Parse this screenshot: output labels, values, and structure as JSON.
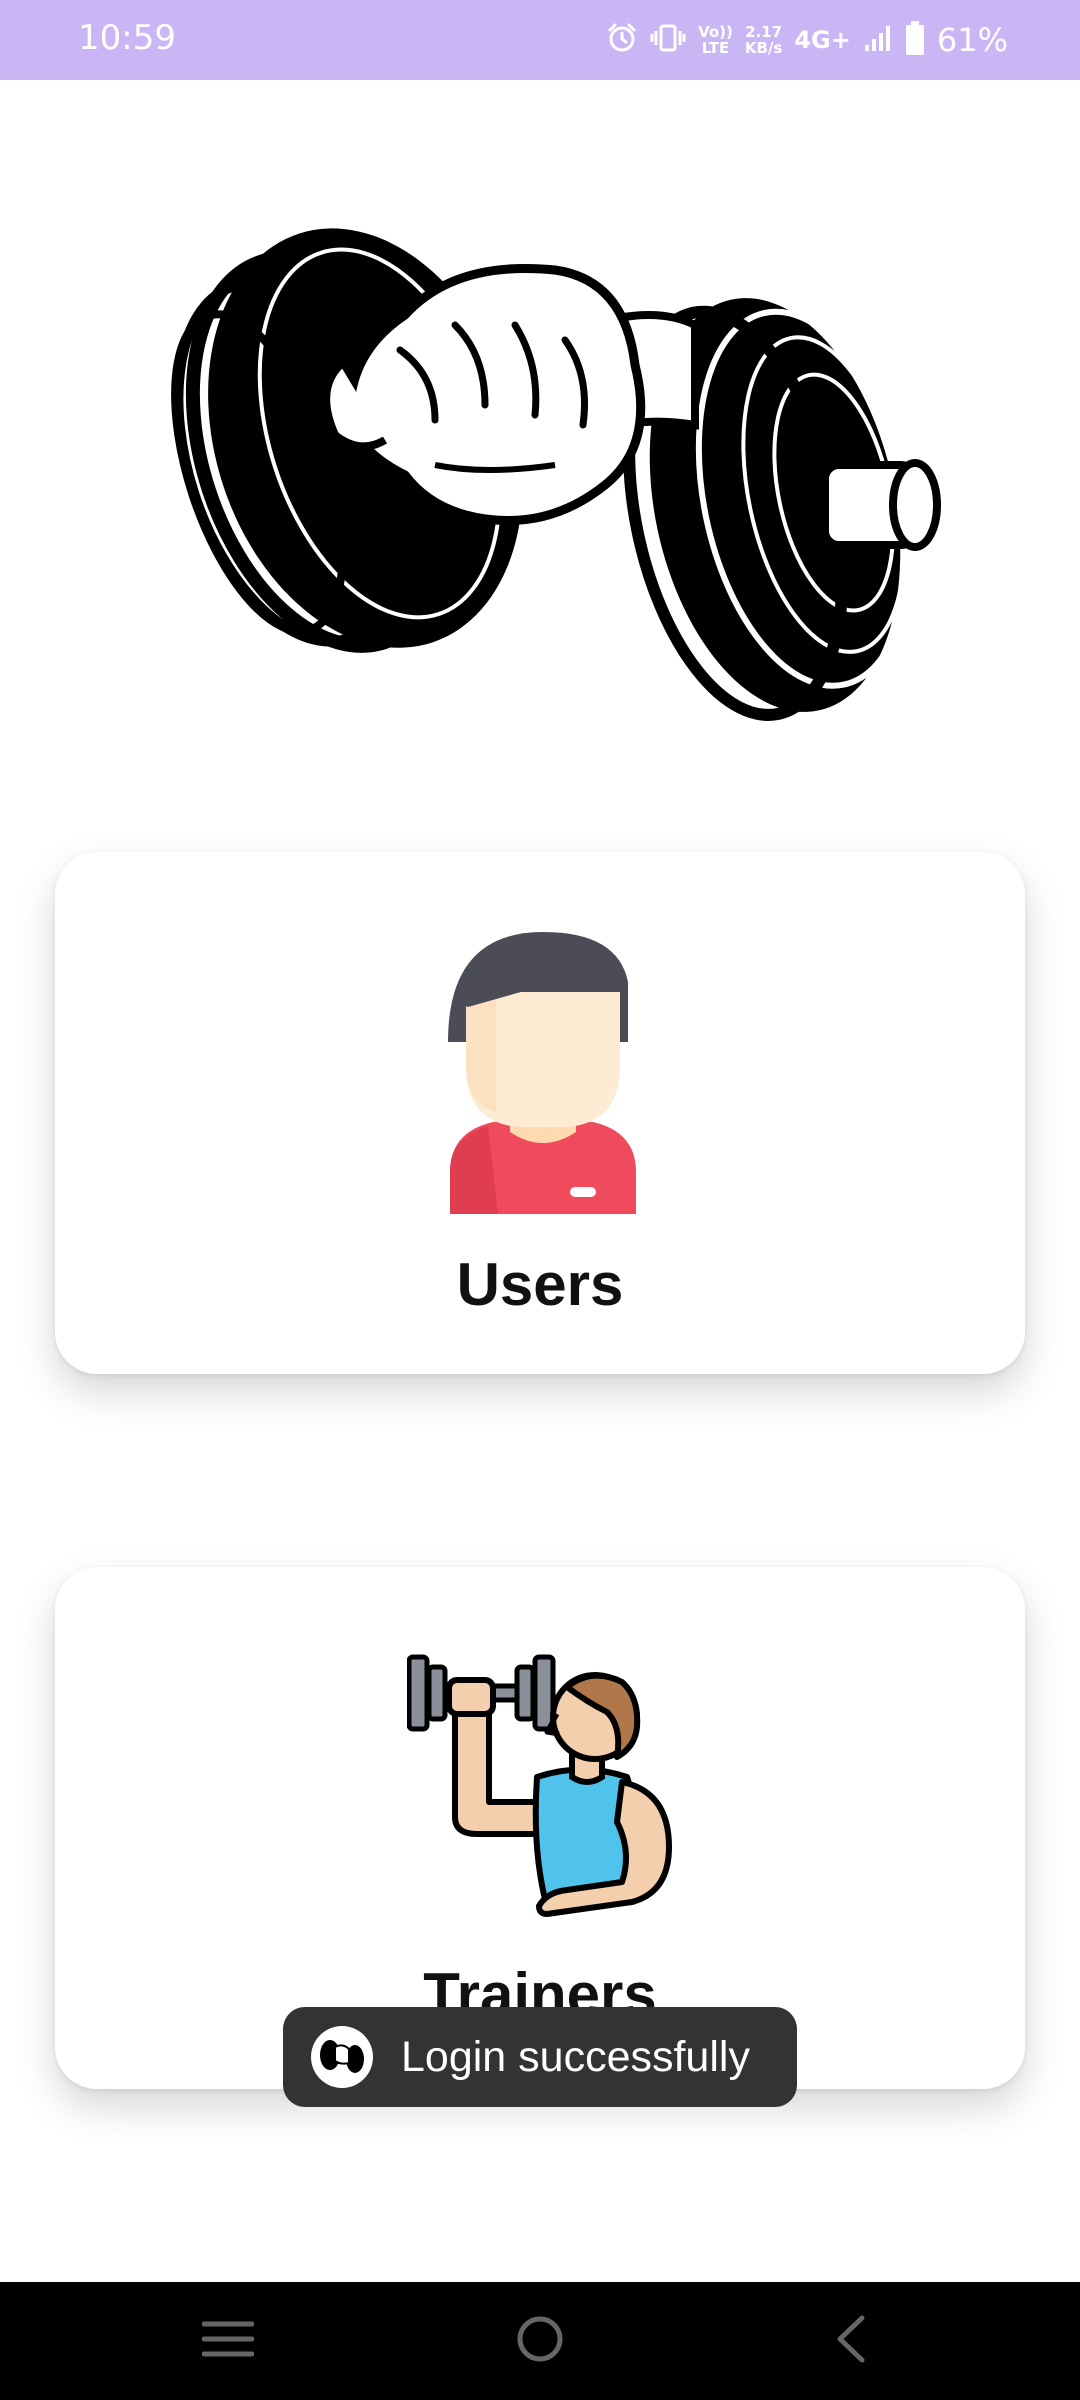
{
  "status_bar": {
    "time": "10:59",
    "volte_top": "Vo))",
    "volte_bottom": "LTE",
    "speed_value": "2.17",
    "speed_unit": "KB/s",
    "network": "4G+",
    "battery_percent": "61%",
    "icons": [
      "alarm-icon",
      "vibrate-icon",
      "signal-icon",
      "battery-icon"
    ],
    "background": "#cbb6f5"
  },
  "hero": {
    "icon": "dumbbell-hand-icon"
  },
  "cards": {
    "users": {
      "label": "Users",
      "icon": "user-avatar-icon"
    },
    "trainers": {
      "label": "Trainers",
      "icon": "trainer-lifting-icon"
    }
  },
  "toast": {
    "text": "Login successfully",
    "icon": "app-logo-icon"
  },
  "nav_bar": {
    "icons": [
      "recents-icon",
      "home-icon",
      "back-icon"
    ]
  }
}
